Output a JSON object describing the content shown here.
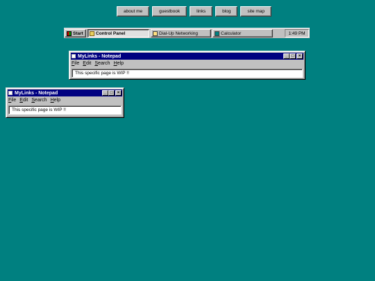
{
  "nav": [
    {
      "label": "about me"
    },
    {
      "label": "guestbook"
    },
    {
      "label": "links"
    },
    {
      "label": "blog"
    },
    {
      "label": "site map"
    }
  ],
  "taskbar": {
    "start_label": "Start",
    "tasks": [
      {
        "label": "Control Panel",
        "icon": "folder-icon",
        "active": true
      },
      {
        "label": "Dial-Up Networking",
        "icon": "dialup-icon",
        "active": false
      },
      {
        "label": "Calculator",
        "icon": "calculator-icon",
        "active": false
      }
    ],
    "clock": "1:49 PM"
  },
  "windows": [
    {
      "title": "MyLinks - Notepad",
      "menu": [
        "File",
        "Edit",
        "Search",
        "Help"
      ],
      "content": "This specific page is WIP !!"
    },
    {
      "title": "MyLinks - Notepad",
      "menu": [
        "File",
        "Edit",
        "Search",
        "Help"
      ],
      "content": "This specific page is WIP !!"
    }
  ],
  "colors": {
    "desktop": "#008080",
    "titlebar": "#000080",
    "face": "#c0c0c0"
  }
}
